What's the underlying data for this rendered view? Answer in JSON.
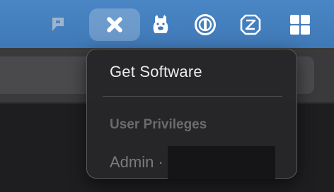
{
  "menubar": {
    "icons": [
      {
        "name": "feedback-icon"
      },
      {
        "name": "self-service-icon"
      },
      {
        "name": "alpaca-icon"
      },
      {
        "name": "1password-icon"
      },
      {
        "name": "dropbox-outline-icon"
      },
      {
        "name": "windows-grid-icon"
      }
    ],
    "accent": "#4a86c5"
  },
  "menu": {
    "get_software": "Get Software",
    "section_header": "User Privileges",
    "admin_label": "Admin ·"
  }
}
